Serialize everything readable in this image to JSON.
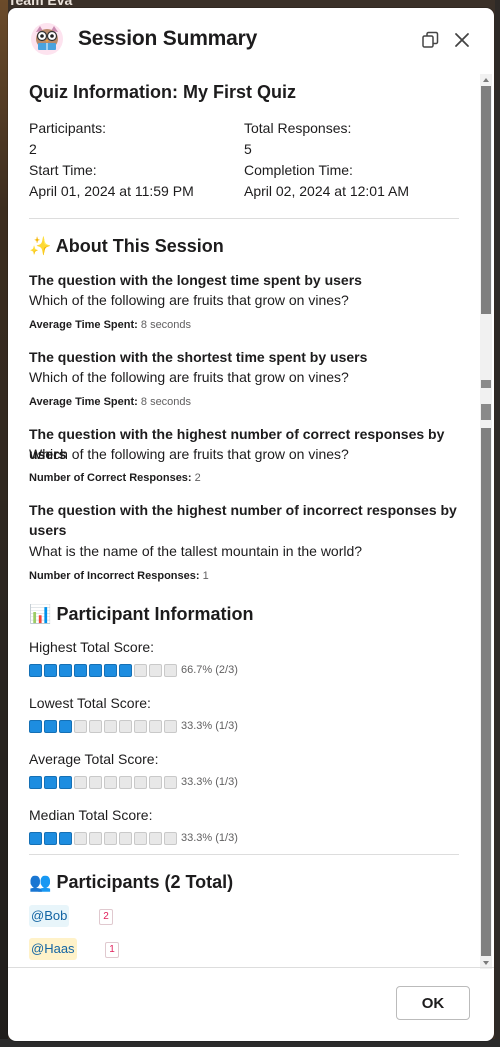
{
  "background": {
    "partial_text": "Team Eva"
  },
  "dialog": {
    "title": "Session Summary",
    "icons": {
      "app": "owl-reading-icon",
      "copy": "copy-icon",
      "close": "close-icon"
    }
  },
  "quiz_info": {
    "heading": "Quiz Information: My First Quiz",
    "participants_label": "Participants:",
    "participants_value": "2",
    "responses_label": "Total Responses:",
    "responses_value": "5",
    "start_label": "Start Time:",
    "start_value": "April 01, 2024 at 11:59 PM",
    "completion_label": "Completion Time:",
    "completion_value": "April 02, 2024 at 12:01 AM"
  },
  "about": {
    "emoji": "✨",
    "heading": "About This Session",
    "items": [
      {
        "heading": "The question with the longest time spent by users",
        "question": "Which of the following are fruits that grow on vines?",
        "meta_label": "Average Time Spent:",
        "meta_value": "8 seconds"
      },
      {
        "heading": "The question with the shortest time spent by users",
        "question": "Which of the following are fruits that grow on vines?",
        "meta_label": "Average Time Spent:",
        "meta_value": "8 seconds"
      },
      {
        "heading": "The question with the highest number of correct responses by users",
        "question": "Which of the following are fruits that grow on vines?",
        "meta_label": "Number of Correct Responses:",
        "meta_value": "2"
      },
      {
        "heading": "The question with the highest number of incorrect responses by users",
        "question": "What is the name of the tallest mountain in the world?",
        "meta_label": "Number of Incorrect Responses:",
        "meta_value": "1"
      }
    ]
  },
  "participant_info": {
    "emoji": "📊",
    "heading": "Participant Information",
    "scores": [
      {
        "label": "Highest Total Score:",
        "fraction": 0.667,
        "text": "66.7% (2/3)"
      },
      {
        "label": "Lowest Total Score:",
        "fraction": 0.333,
        "text": "33.3% (1/3)"
      },
      {
        "label": "Average Total Score:",
        "fraction": 0.333,
        "text": "33.3% (1/3)"
      },
      {
        "label": "Median Total Score:",
        "fraction": 0.333,
        "text": "33.3% (1/3)"
      }
    ]
  },
  "participants": {
    "emoji": "👥",
    "heading": "Participants (2 Total)",
    "list": [
      {
        "name": "@Bob",
        "count": "2",
        "highlight": false
      },
      {
        "name": "@Haas",
        "count": "1",
        "highlight": true
      }
    ]
  },
  "footer": {
    "ok_label": "OK"
  },
  "colors": {
    "bar_on": "#1d8de0",
    "bar_off": "#e8e8e8",
    "mention": "#1264a3",
    "badge": "#e01e5a"
  }
}
